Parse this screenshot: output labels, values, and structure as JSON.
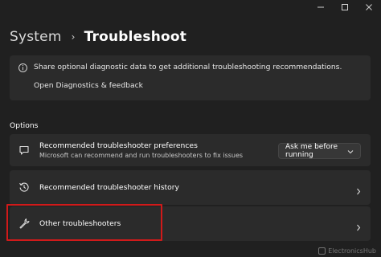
{
  "window": {
    "controls": [
      "minimize-icon",
      "maximize-icon",
      "close-icon"
    ]
  },
  "breadcrumb": {
    "parent": "System",
    "separator": "›",
    "current": "Troubleshoot"
  },
  "info_card": {
    "icon": "info-icon",
    "text": "Share optional diagnostic data to get additional troubleshooting recommendations.",
    "link": "Open Diagnostics & feedback"
  },
  "options": {
    "section_label": "Options",
    "items": [
      {
        "icon": "chat-bubble-icon",
        "title": "Recommended troubleshooter preferences",
        "subtitle": "Microsoft can recommend and run troubleshooters to fix issues",
        "dropdown_value": "Ask me before running"
      },
      {
        "icon": "history-icon",
        "title": "Recommended troubleshooter history"
      },
      {
        "icon": "wrench-icon",
        "title": "Other troubleshooters"
      }
    ]
  },
  "watermark": {
    "text": "ElectronicsHub"
  },
  "colors": {
    "background": "#202020",
    "card": "#2b2b2b",
    "highlight": "#d11a1a"
  }
}
